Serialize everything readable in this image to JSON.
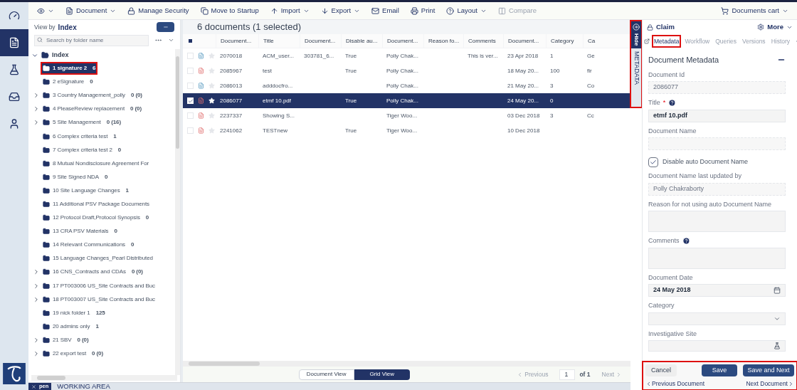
{
  "rail": [
    {
      "selected": false
    },
    {
      "selected": true
    },
    {
      "selected": false
    },
    {
      "selected": false
    },
    {
      "selected": false
    }
  ],
  "toolbar": [
    {
      "kind": "eye",
      "dropdown": true,
      "disabled": false
    },
    {
      "kind": "document",
      "label": "Document",
      "dropdown": true,
      "disabled": false
    },
    {
      "kind": "lock",
      "label": "Manage Security",
      "dropdown": false,
      "disabled": false
    },
    {
      "kind": "move",
      "label": "Move to Startup",
      "dropdown": false,
      "disabled": false
    },
    {
      "kind": "up",
      "label": "Import",
      "dropdown": true,
      "disabled": false
    },
    {
      "kind": "down",
      "label": "Export",
      "dropdown": true,
      "disabled": false
    },
    {
      "kind": "mail",
      "label": "Email",
      "dropdown": false,
      "disabled": false
    },
    {
      "kind": "print",
      "label": "Print",
      "dropdown": false,
      "disabled": false
    },
    {
      "kind": "help",
      "label": "Layout",
      "dropdown": true,
      "disabled": false
    },
    {
      "kind": "columns",
      "label": "Compare",
      "dropdown": false,
      "disabled": true
    }
  ],
  "cart": {
    "label": "Documents cart"
  },
  "folders": {
    "view_by_label": "View by",
    "view_by_value": "Index",
    "search_placeholder": "Search by folder name",
    "root": {
      "name": "Index",
      "expanded": true,
      "children": [
        {
          "name": "1 signature 2",
          "count": "6",
          "expandable": false,
          "selected": true,
          "annotated": true
        },
        {
          "name": "2 eSignature",
          "count": "0",
          "expandable": false,
          "selected": false,
          "annotated": false
        },
        {
          "name": "3 Country Management_polly",
          "count": "0 (0)",
          "expandable": true,
          "selected": false,
          "annotated": false
        },
        {
          "name": "4 PleaseReview replacement",
          "count": "0 (0)",
          "expandable": true,
          "selected": false,
          "annotated": false
        },
        {
          "name": "5 Site Management",
          "count": "0 (16)",
          "expandable": true,
          "selected": false,
          "annotated": false
        },
        {
          "name": "6 Complex criteria test",
          "count": "1",
          "expandable": false,
          "selected": false,
          "annotated": false
        },
        {
          "name": "7 Complex criteria test 2",
          "count": "0",
          "expandable": false,
          "selected": false,
          "annotated": false
        },
        {
          "name": "8 Mutual Nondisclosure Agreement For",
          "expandable": false,
          "selected": false,
          "annotated": false
        },
        {
          "name": "9 Site Signed NDA",
          "count": "0",
          "expandable": false,
          "selected": false,
          "annotated": false
        },
        {
          "name": "10 Site Language Changes",
          "count": "1",
          "expandable": false,
          "selected": false,
          "annotated": false
        },
        {
          "name": "11 Additional PSV Package Documents",
          "expandable": false,
          "selected": false,
          "annotated": false
        },
        {
          "name": "12 Protocol Draft,Protocol Synopsis",
          "count": "0",
          "expandable": false,
          "selected": false,
          "annotated": false
        },
        {
          "name": "13 CRA PSV Materials",
          "count": "0",
          "expandable": false,
          "selected": false,
          "annotated": false
        },
        {
          "name": "14 Relevant Communications",
          "count": "0",
          "expandable": false,
          "selected": false,
          "annotated": false
        },
        {
          "name": "15 Language Changes_Pearl Distributed",
          "expandable": false,
          "selected": false,
          "annotated": false
        },
        {
          "name": "16 CNS_Contracts and CDAs",
          "count": "0 (0)",
          "expandable": true,
          "selected": false,
          "annotated": false
        },
        {
          "name": "17 PT003006 US_Site Contracts and Buc",
          "expandable": true,
          "selected": false,
          "annotated": false
        },
        {
          "name": "18 PT003007 US_Site Contracts and Buc",
          "expandable": true,
          "selected": false,
          "annotated": false
        },
        {
          "name": "19 nick folder 1",
          "count": "125",
          "expandable": false,
          "selected": false,
          "annotated": false
        },
        {
          "name": "20 admins only",
          "count": "1",
          "expandable": false,
          "selected": false,
          "annotated": false
        },
        {
          "name": "21 SBV",
          "count": "0 (0)",
          "expandable": true,
          "selected": false,
          "annotated": false
        },
        {
          "name": "22 export test",
          "count": "0 (0)",
          "expandable": true,
          "selected": false,
          "annotated": false
        }
      ]
    }
  },
  "grid": {
    "title": "6 documents (1 selected)",
    "columns": [
      "Document...",
      "Title",
      "Document...",
      "Disable au...",
      "Document...",
      "Reason fo...",
      "Comments",
      "Document...",
      "Category",
      "Ca"
    ],
    "rows": [
      {
        "selected": false,
        "starred": false,
        "kind": "doc",
        "cells": [
          "2070018",
          "ACM_user...",
          "303781_6...",
          "True",
          "Polly Chak...",
          null,
          "This is ver...",
          "23 Apr 2018",
          "1",
          "Ge"
        ]
      },
      {
        "selected": false,
        "starred": false,
        "kind": "pdf",
        "cells": [
          "2085967",
          "test",
          null,
          "True",
          "Polly Chak...",
          null,
          null,
          "18 May 20...",
          "100",
          "fir"
        ]
      },
      {
        "selected": false,
        "starred": false,
        "kind": "doc",
        "cells": [
          "2086013",
          "adddocfro...",
          null,
          null,
          "Polly Chak...",
          null,
          null,
          "21 May 20...",
          "3",
          "Co"
        ]
      },
      {
        "selected": true,
        "starred": true,
        "kind": "pdf",
        "cells": [
          "2086077",
          "etmf 10.pdf",
          null,
          "True",
          "Polly Chak...",
          null,
          null,
          "24 May 20...",
          "0",
          null
        ]
      },
      {
        "selected": false,
        "starred": false,
        "kind": "pdf",
        "cells": [
          "2237337",
          "Showing S...",
          null,
          null,
          "Tiger Woo...",
          null,
          null,
          "03 Dec 2018",
          "3",
          "Cc"
        ]
      },
      {
        "selected": false,
        "starred": false,
        "kind": "pdf",
        "cells": [
          "2241062",
          "TESTnew",
          null,
          "True",
          "Tiger Woo...",
          null,
          null,
          "10 Dec 2018",
          null,
          null
        ]
      }
    ],
    "views": [
      {
        "label": "Document View",
        "selected": false
      },
      {
        "label": "Grid View",
        "selected": true
      }
    ],
    "pager": {
      "previous": "Previous",
      "previous_disabled": true,
      "page": "1",
      "of": "of 1",
      "next": "Next"
    }
  },
  "side_tab": {
    "hide": "Hide",
    "label": "METADATA",
    "annotated": true
  },
  "panel": {
    "claim": "Claim",
    "more": "More",
    "tabs": [
      {
        "label": "Metadata",
        "selected": true,
        "annotated": true
      },
      {
        "label": "Workflow",
        "selected": false,
        "annotated": false
      },
      {
        "label": "Queries",
        "selected": false,
        "annotated": false
      },
      {
        "label": "Versions",
        "selected": false,
        "annotated": false
      },
      {
        "label": "History",
        "selected": false,
        "annotated": false
      }
    ],
    "section": "Document Metadata",
    "fields": [
      {
        "kind": "text",
        "label": "Document Id",
        "value": "2086077",
        "disabled": true,
        "help": false
      },
      {
        "kind": "text",
        "label": "Title",
        "required_mark": "*",
        "value": "etmf 10.pdf",
        "disabled": false,
        "help": true
      },
      {
        "kind": "text",
        "label": "Document Name",
        "disabled": true,
        "help": false
      },
      {
        "kind": "checkbox",
        "label": "Disable auto Document Name",
        "checked": true
      },
      {
        "kind": "text",
        "label": "Document Name last updated by",
        "value": "Polly Chakraborty",
        "disabled": true,
        "help": false
      },
      {
        "kind": "textarea",
        "label": "Reason for not using auto Document Name",
        "help": false
      },
      {
        "kind": "textarea",
        "label": "Comments",
        "help": true
      },
      {
        "kind": "date",
        "label": "Document Date",
        "value": "24 May 2018"
      },
      {
        "kind": "select",
        "label": "Category"
      },
      {
        "kind": "lookup",
        "label": "Investigative Site"
      }
    ],
    "footer": {
      "annotated": true,
      "cancel": "Cancel",
      "save": "Save",
      "save_next": "Save and Next",
      "previous": "Previous Document",
      "next": "Next Document"
    }
  },
  "status_bar": {
    "tab": "pen",
    "area": "WORKING AREA"
  }
}
